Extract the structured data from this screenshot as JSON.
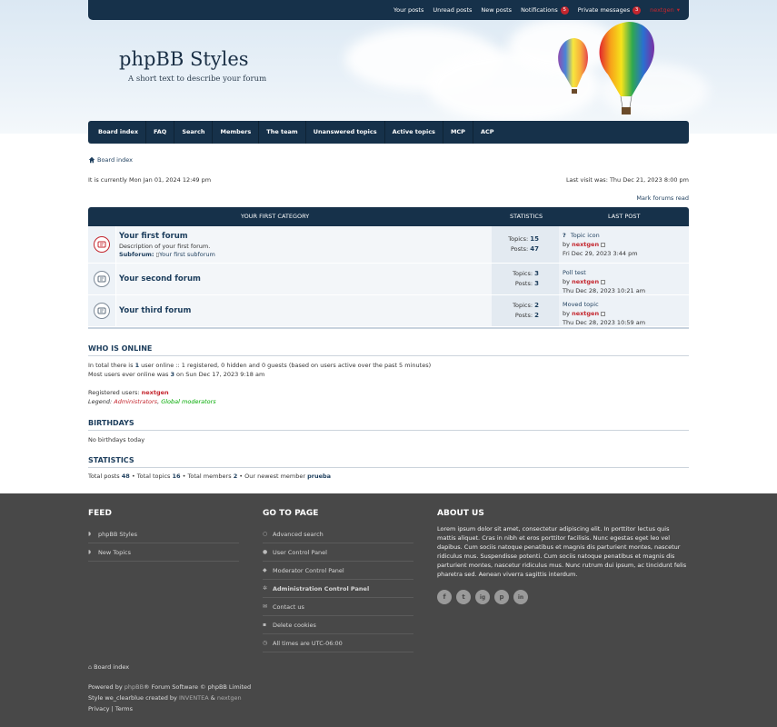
{
  "topbar": {
    "links": [
      "Your posts",
      "Unread posts",
      "New posts"
    ],
    "notifications_label": "Notifications",
    "notifications_count": "5",
    "pm_label": "Private messages",
    "pm_count": "3",
    "username": "nextgen"
  },
  "header": {
    "title": "phpBB Styles",
    "description": "A short text to describe your forum"
  },
  "nav": [
    "Board index",
    "FAQ",
    "Search",
    "Members",
    "The team",
    "Unanswered topics",
    "Active topics",
    "MCP",
    "ACP"
  ],
  "breadcrumb": "Board index",
  "current_time": "It is currently Mon Jan 01, 2024 12:49 pm",
  "last_visit": "Last visit was: Thu Dec 21, 2023 8:00 pm",
  "mark_read": "Mark forums read",
  "forumlist": {
    "category": "YOUR FIRST CATEGORY",
    "col_stats": "STATISTICS",
    "col_last": "LAST POST",
    "forums": [
      {
        "title": "Your first forum",
        "description": "Description of your first forum.",
        "subforum_label": "Subforum:",
        "subforum": "Your first subforum",
        "topics_label": "Topics:",
        "topics": "15",
        "posts_label": "Posts:",
        "posts": "47",
        "last_title": "Topic icon",
        "by": "by",
        "last_author": "nextgen",
        "last_date": "Fri Dec 29, 2023 3:44 pm"
      },
      {
        "title": "Your second forum",
        "topics_label": "Topics:",
        "topics": "3",
        "posts_label": "Posts:",
        "posts": "3",
        "last_title": "Poll test",
        "by": "by",
        "last_author": "nextgen",
        "last_date": "Thu Dec 28, 2023 10:21 am"
      },
      {
        "title": "Your third forum",
        "topics_label": "Topics:",
        "topics": "2",
        "posts_label": "Posts:",
        "posts": "2",
        "last_title": "Moved topic",
        "by": "by",
        "last_author": "nextgen",
        "last_date": "Thu Dec 28, 2023 10:59 am"
      }
    ]
  },
  "online": {
    "heading": "WHO IS ONLINE",
    "line1_a": "In total there is ",
    "line1_count": "1",
    "line1_b": " user online :: 1 registered, 0 hidden and 0 guests (based on users active over the past 5 minutes)",
    "line2_a": "Most users ever online was ",
    "line2_count": "3",
    "line2_b": " on Sun Dec 17, 2023 9:18 am",
    "registered_label": "Registered users: ",
    "registered_user": "nextgen",
    "legend_label": "Legend: ",
    "legend_admin": "Administrators",
    "legend_sep": ", ",
    "legend_mod": "Global moderators"
  },
  "birthdays": {
    "heading": "BIRTHDAYS",
    "text": "No birthdays today"
  },
  "statistics": {
    "heading": "STATISTICS",
    "posts_label": "Total posts ",
    "posts": "48",
    "topics_label": " • Total topics ",
    "topics": "16",
    "members_label": " • Total members ",
    "members": "2",
    "newest_label": " • Our newest member ",
    "newest": "prueba"
  },
  "footer": {
    "feed_title": "FEED",
    "feed_items": [
      "phpBB Styles",
      "New Topics"
    ],
    "goto_title": "GO TO PAGE",
    "goto_items": [
      "Advanced search",
      "User Control Panel",
      "Moderator Control Panel",
      "Administration Control Panel",
      "Contact us",
      "Delete cookies",
      "All times are UTC-06:00"
    ],
    "about_title": "ABOUT US",
    "about_text": "Lorem ipsum dolor sit amet, consectetur adipiscing elit. In porttitor lectus quis mattis aliquet. Cras in nibh et eros porttitor facilisis. Nunc egestas eget leo vel dapibus. Cum sociis natoque penatibus et magnis dis parturient montes, nascetur ridiculus mus. Suspendisse potenti. Cum sociis natoque penatibus et magnis dis parturient montes, nascetur ridiculus mus. Nunc rutrum dui ipsum, ac tincidunt felis pharetra sed. Aenean viverra sagittis interdum.",
    "social": [
      "f",
      "t",
      "ig",
      "p",
      "in"
    ],
    "board_index": "Board index",
    "powered_a": "Powered by ",
    "powered_link": "phpBB",
    "powered_b": "® Forum Software © phpBB Limited",
    "style_a": "Style we_clearblue created by ",
    "style_link1": "INVENTEA",
    "style_amp": " & ",
    "style_link2": "nextgen",
    "privacy": "Privacy",
    "sep": " | ",
    "terms": "Terms"
  }
}
